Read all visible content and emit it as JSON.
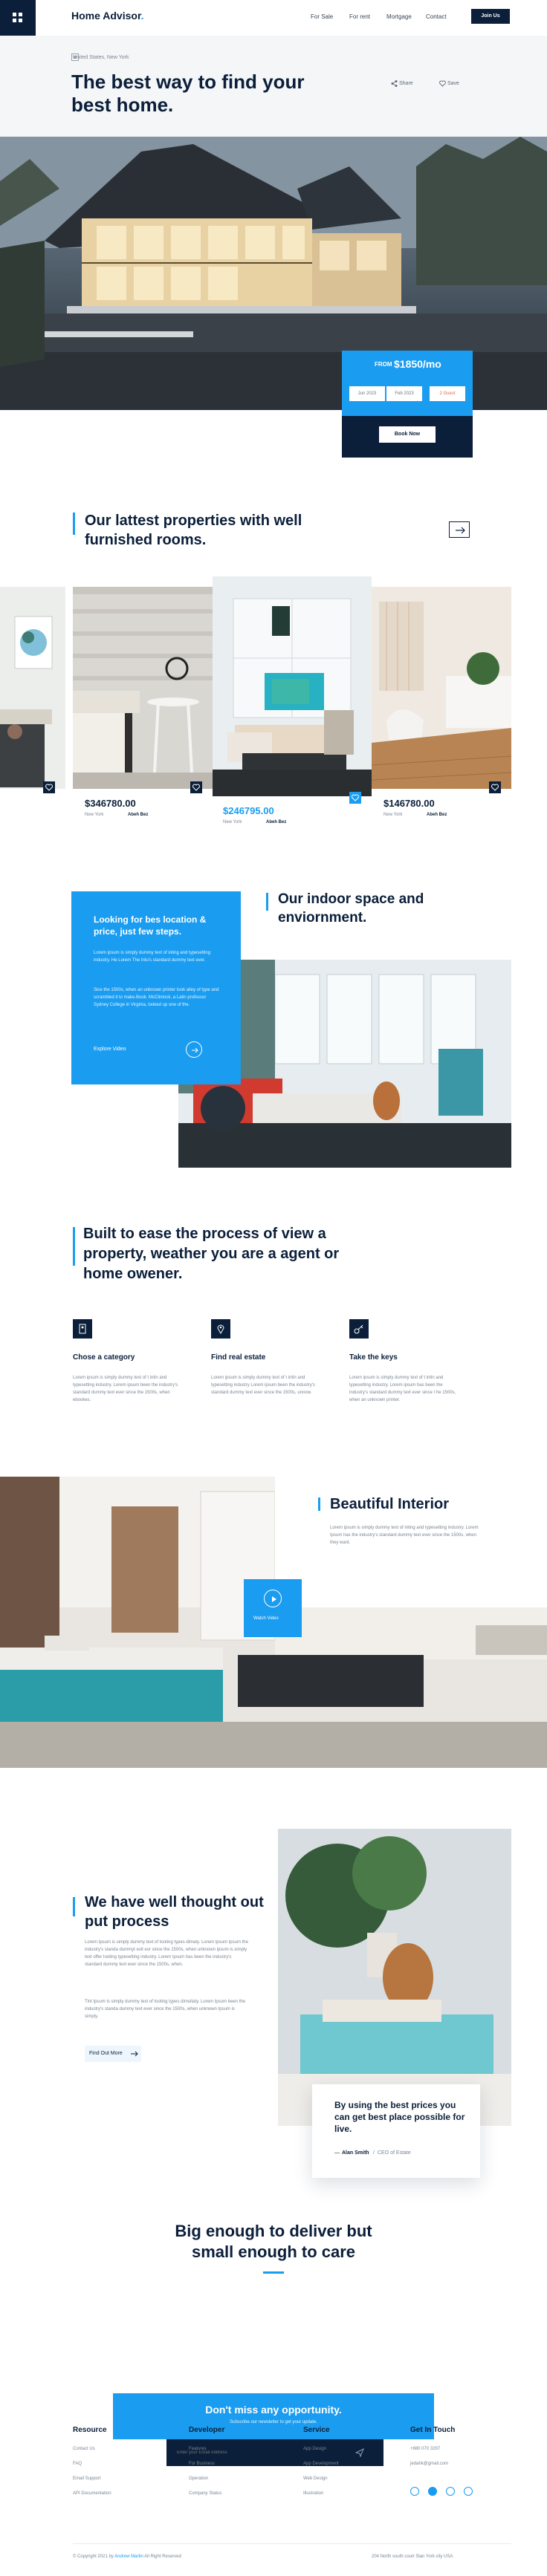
{
  "header": {
    "logo": "Home Advisor",
    "logo_dot": ".",
    "nav": [
      "For Sale",
      "For rent",
      "Mortgage",
      "Contact"
    ],
    "join_label": "Join Us"
  },
  "hero": {
    "breadcrumb": "United States, New York",
    "title": "The best way to find your best home.",
    "share_label": "Share",
    "save_label": "Save",
    "price_label": "FROM",
    "price_value": "$1850/mo",
    "date_in": "Jun 2023",
    "date_out": "Feb 2023",
    "guests": "2 Guest",
    "book_label": "Book Now"
  },
  "latest": {
    "title": "Our lattest properties with well furnished rooms.",
    "cards": [
      {
        "price": "$346780.00",
        "location": "New York",
        "agent": "Abeh Bez"
      },
      {
        "price": "$246795.00",
        "location": "New York",
        "agent": "Abeh Bez"
      },
      {
        "price": "$146780.00",
        "location": "New York",
        "agent": "Abeh Bez"
      }
    ]
  },
  "indoor": {
    "card_title": "Looking for bes location & price, just few steps.",
    "card_p1": "Lorem ipsum is simply dummy text of inting and typesetting industry. He Lorem The Intu's standard dummy text ever.",
    "card_p2": "Sice the 1500s, when an unknown printer took alley of type and scrambled it to make.Book. McClintock, a Latin professor Sydney College in Virginia, looked up one of the.",
    "explore_label": "Explore Video",
    "title": "Our indoor space and enviornment."
  },
  "process": {
    "title": "Built to ease the process of view a property, weather you are a agent or home owener.",
    "features": [
      {
        "title": "Chose a category",
        "text": "Lorem ipsum is simply dummy text of t intin and typesetting industry. Lorem ipsum been the industry's standard dummy text ever since the 1500s, when ebookes."
      },
      {
        "title": "Find real estate",
        "text": "Lorem ipsum is simply dummy text of t intin and typesetting industry Lorem ipsum been the industry's standard dummy text ever since the 1500s, unnow."
      },
      {
        "title": "Take the keys",
        "text": "Lorem ipsum is simply dummy text of t intin and typesetting industry. Lorem ipsum has been the industry's standard dummy text ever since t he 1500s, when an unknown printer."
      }
    ]
  },
  "interior": {
    "title": "Beautiful Interior",
    "text": "Lorem ipsum is simply dummy text of inting and typesetting industry. Lorem Ipsum has the industry's standard dummy text ever since the 1500s, when they want.",
    "watch_label": "Watch Video"
  },
  "thought": {
    "title": "We have well thought out put process",
    "p1": "Lorem Ipsum is simply dummy text of tooting types dimaty. Lorem Ipsum Ipsum the industry's standa dummyt exit evr since the 1500s, when unknown ipsum is simply text offer Iooting typesetting industry. Lorem Ipsum has been the industry's standard dummy text ever since the 1500s, when.",
    "p2": "Tint Ipsum is simply dummy text of tooting types dimultaty. Lorem Ipsum been the industry's standa dummy text ever since the 1500s, when unknown Ipsum is simply.",
    "button_label": "Find Out More",
    "quote": "By using the best prices you can get best place possible for live.",
    "quote_author": "Alan Smith",
    "quote_role": "CEO of Estate"
  },
  "cta": {
    "title": "Big enough to deliver but small enough to care",
    "news_title": "Don't miss any opportunity.",
    "news_sub": "Subscribe our newsletter to get your update.",
    "email_placeholder": "Enter your Email Address"
  },
  "footer": {
    "columns": [
      {
        "title": "Resource",
        "links": [
          "Contact Us",
          "FAQ",
          "Email Support",
          "API Documentation"
        ]
      },
      {
        "title": "Developer",
        "links": [
          "Features",
          "For Business",
          "Operation",
          "Company Status"
        ]
      },
      {
        "title": "Service",
        "links": [
          "App Design",
          "App Development",
          "Web Design",
          "Illustration"
        ]
      }
    ],
    "touch_title": "Get In Touch",
    "phone": "+880 070 3297",
    "email": "jedahk@gmail.com",
    "copyright_prefix": "© Copyright 2021 by",
    "copyright_brand": "Andrew Martin",
    "copyright_suffix": "All Right Reserved",
    "address": "204 North south court Slan York city USA",
    "colors": {
      "accent": "#1a9cf0",
      "navy": "#0b1f3a"
    }
  }
}
